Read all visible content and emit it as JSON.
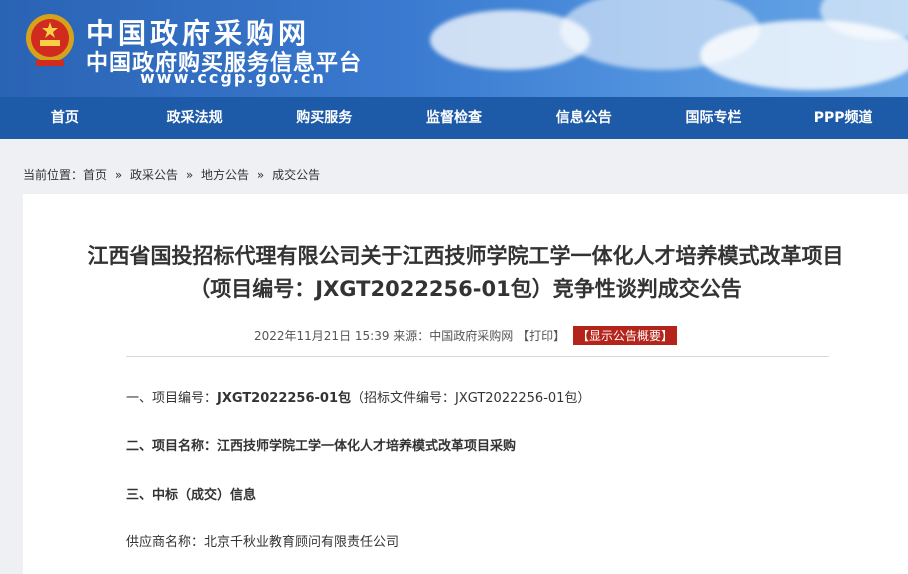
{
  "header": {
    "site_name": "中国政府采购网",
    "site_subtitle": "中国政府购买服务信息平台",
    "site_url": "www.ccgp.gov.cn",
    "emblem_icon": "national-emblem-icon"
  },
  "nav": {
    "items": [
      {
        "label": "首页"
      },
      {
        "label": "政采法规"
      },
      {
        "label": "购买服务"
      },
      {
        "label": "监督检查"
      },
      {
        "label": "信息公告"
      },
      {
        "label": "国际专栏"
      },
      {
        "label": "PPP频道"
      }
    ]
  },
  "breadcrumb": {
    "prefix": "当前位置：",
    "items": [
      "首页",
      "政采公告",
      "地方公告",
      "成交公告"
    ],
    "separator": "»"
  },
  "article": {
    "title_line1": "江西省国投招标代理有限公司关于江西技师学院工学一体化人才培养模式改革项目",
    "title_line2": "（项目编号：JXGT2022256-01包）竞争性谈判成交公告",
    "meta_datetime": "2022年11月21日 15:39",
    "meta_source": "来源：中国政府采购网",
    "meta_print": "【打印】",
    "meta_summary": "【显示公告概要】",
    "p1_label": "一、项目编号：",
    "p1_value": "JXGT2022256-01包",
    "p1_extra": "（招标文件编号：JXGT2022256-01包）",
    "p2_label": "二、项目名称：",
    "p2_value": "江西技师学院工学一体化人才培养模式改革项目采购",
    "p3_label": "三、中标（成交）信息",
    "p4_label": "供应商名称：",
    "p4_value": "北京千秋业教育顾问有限责任公司"
  },
  "colors": {
    "nav_bg": "#1d5aa8",
    "summary_badge": "#b4241b"
  }
}
